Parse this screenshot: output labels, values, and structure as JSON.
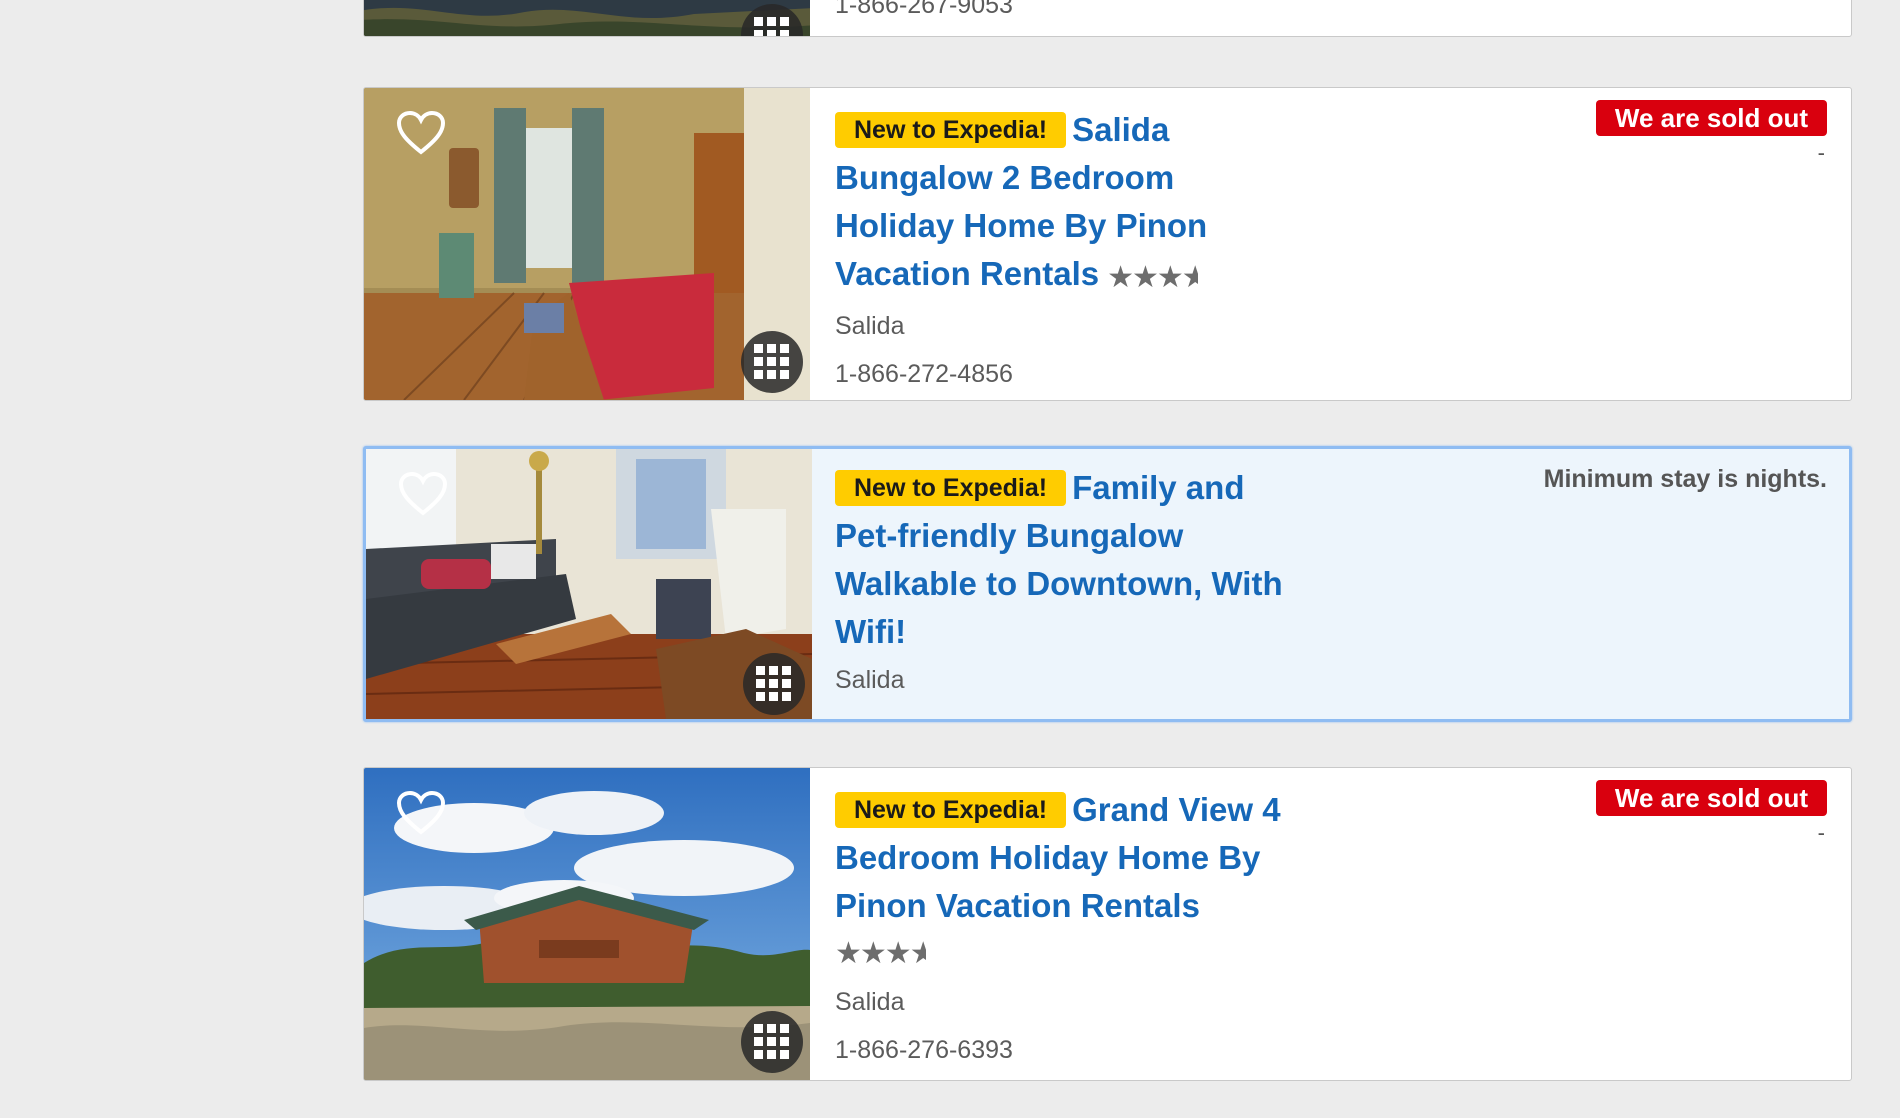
{
  "listings": [
    {
      "phone": "1-866-267-9053"
    },
    {
      "badge": "New to Expedia!",
      "title_lines": [
        "Salida",
        "Bungalow 2 Bedroom",
        "Holiday Home By Pinon",
        "Vacation Rentals"
      ],
      "rating": 3.5,
      "rating_stars": "★★★",
      "location": "Salida",
      "phone": "1-866-272-4856",
      "status": "We are sold out",
      "price": "-"
    },
    {
      "badge": "New to Expedia!",
      "title_lines": [
        "Family and",
        "Pet-friendly Bungalow",
        "Walkable to Downtown, With",
        "Wifi!"
      ],
      "location": "Salida",
      "notice": "Minimum stay is nights."
    },
    {
      "badge": "New to Expedia!",
      "title_lines": [
        "Grand View 4",
        "Bedroom Holiday Home By",
        "Pinon Vacation Rentals"
      ],
      "rating": 3.5,
      "rating_stars": "★★★",
      "location": "Salida",
      "phone": "1-866-276-6393",
      "status": "We are sold out",
      "price": "-"
    }
  ],
  "icons": {
    "favorite": "heart-outline-icon",
    "gallery": "grid-icon",
    "half_star": "★"
  },
  "colors": {
    "link": "#1668b8",
    "badge": "#ffcc00",
    "soldout": "#d9000e",
    "highlight_bg": "#edf5fc",
    "highlight_border": "#8fbcf2"
  }
}
